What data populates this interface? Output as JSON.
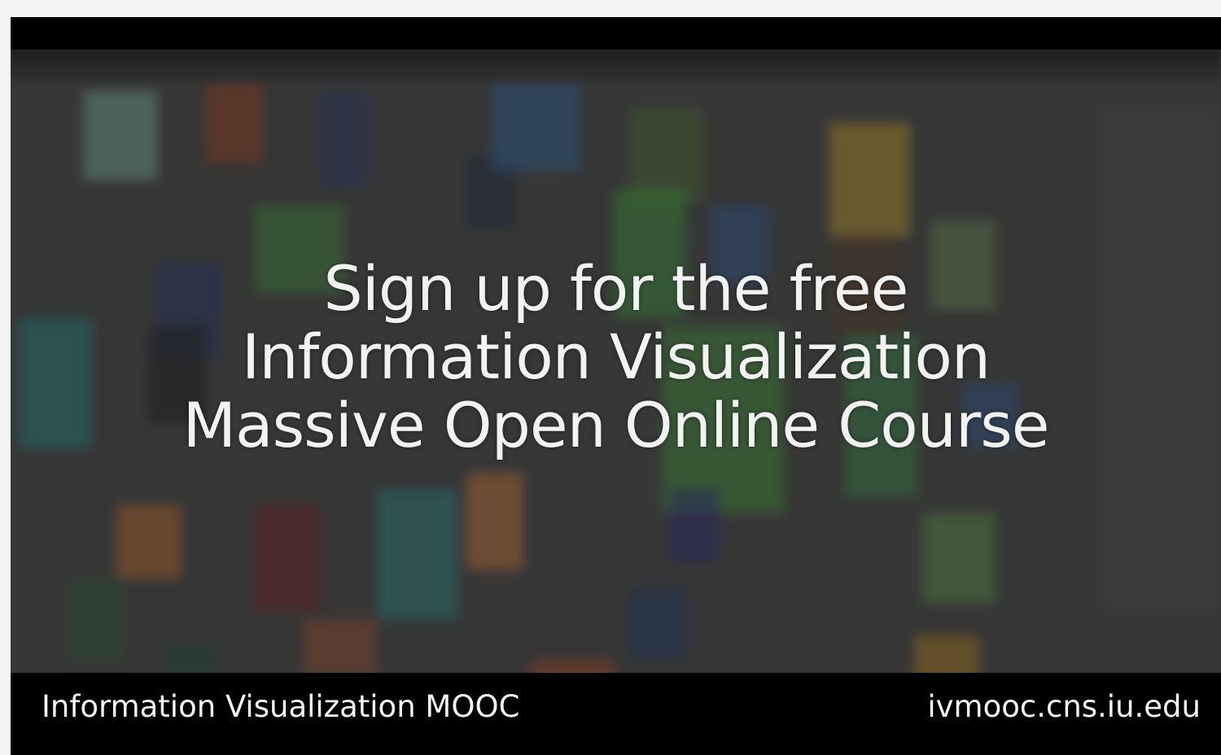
{
  "headline": {
    "line1": "Sign up for the free",
    "line2": "Information Visualization",
    "line3": "Massive Open Online Course"
  },
  "footer": {
    "left_text": "Information Visualization MOOC",
    "right_text": "ivmooc.cns.iu.edu"
  },
  "colors": {
    "bars": "#000000",
    "video_background": "#3f3f3f",
    "text": "#f2f2f2"
  }
}
